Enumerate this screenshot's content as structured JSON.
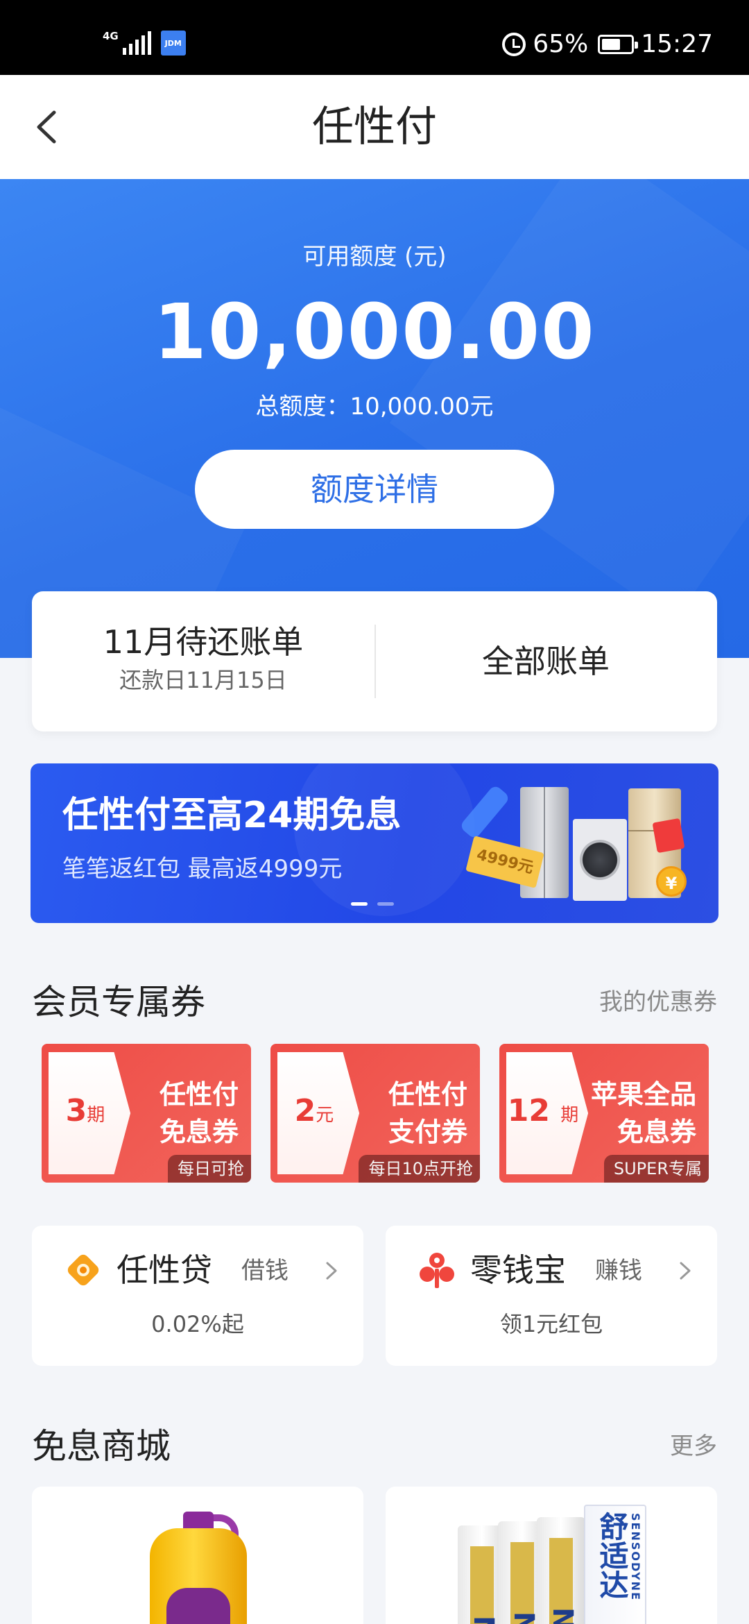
{
  "status_bar": {
    "network": "4G",
    "app_badge": "JDM",
    "battery": "65%",
    "battery_level": 0.65,
    "time": "15:27"
  },
  "nav": {
    "title": "任性付"
  },
  "credit": {
    "label": "可用额度 (元)",
    "amount": "10,000.00",
    "total": "总额度：10,000.00元",
    "detail_button": "额度详情"
  },
  "bill": {
    "title": "11月待还账单",
    "due_date": "还款日11月15日",
    "all_bills": "全部账单"
  },
  "banner": {
    "title": "任性付至高24期免息",
    "subtitle": "笔笔返红包 最高返4999元",
    "ticket_text": "4999元",
    "coin_text": "¥",
    "slide_count": 2,
    "active_slide": 1
  },
  "coupons_section": {
    "title": "会员专属券",
    "link": "我的优惠券",
    "items": [
      {
        "value": "3",
        "unit": "期",
        "name_line1": "任性付",
        "name_line2": "免息券",
        "tag": "每日可抢"
      },
      {
        "value": "2",
        "unit": "元",
        "name_line1": "任性付",
        "name_line2": "支付券",
        "tag": "每日10点开抢"
      },
      {
        "value": "12",
        "unit": "期",
        "name_line1": "苹果全品",
        "name_line2": "免息券",
        "tag": "SUPER专属"
      }
    ]
  },
  "services": [
    {
      "name": "任性贷",
      "action": "借钱",
      "desc": "0.02%起",
      "icon": "loan-icon"
    },
    {
      "name": "零钱宝",
      "action": "赚钱",
      "desc": "领1元红包",
      "icon": "wallet-icon"
    }
  ],
  "mall": {
    "title": "免息商城",
    "link": "更多",
    "paste_brand": "舒适达",
    "paste_brand_en": "SENSODYNE",
    "paste_tube_text": "NE"
  },
  "colors": {
    "primary": "#2e6fe6",
    "coupon_red": "#ee4c46",
    "background": "#f3f5f9"
  }
}
